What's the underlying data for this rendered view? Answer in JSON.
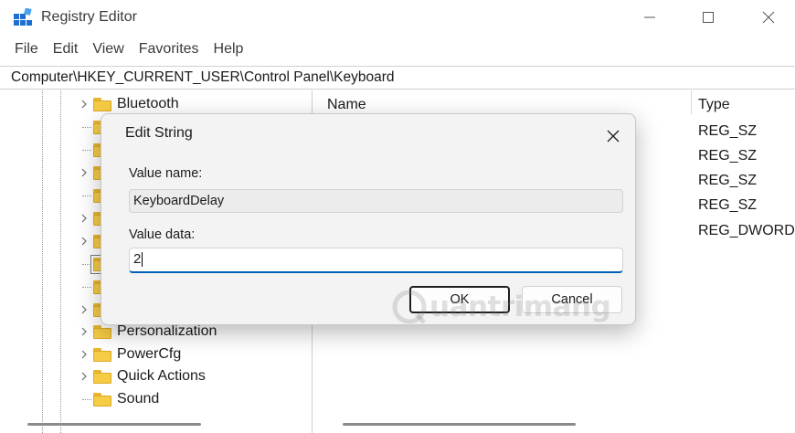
{
  "window": {
    "title": "Registry Editor",
    "icon": "registry-icon",
    "controls": [
      "minimize-icon",
      "maximize-icon",
      "close-icon"
    ]
  },
  "menu": {
    "items": [
      "File",
      "Edit",
      "View",
      "Favorites",
      "Help"
    ]
  },
  "address": {
    "path": "Computer\\HKEY_CURRENT_USER\\Control Panel\\Keyboard"
  },
  "tree": {
    "items": [
      {
        "label": "Bluetooth",
        "expandable": true
      },
      {
        "label": "",
        "expandable": false
      },
      {
        "label": "",
        "expandable": false
      },
      {
        "label": "",
        "expandable": true
      },
      {
        "label": "",
        "expandable": false
      },
      {
        "label": "",
        "expandable": true
      },
      {
        "label": "",
        "expandable": true
      },
      {
        "label": "",
        "expandable": false,
        "selected": true
      },
      {
        "label": "",
        "expandable": false
      },
      {
        "label": "",
        "expandable": true
      },
      {
        "label": "Personalization",
        "expandable": true
      },
      {
        "label": "PowerCfg",
        "expandable": true
      },
      {
        "label": "Quick Actions",
        "expandable": true
      },
      {
        "label": "Sound",
        "expandable": false
      }
    ]
  },
  "list": {
    "columns": {
      "name": "Name",
      "type": "Type"
    },
    "types": [
      "REG_SZ",
      "REG_SZ",
      "REG_SZ",
      "REG_SZ",
      "REG_DWORD"
    ]
  },
  "dialog": {
    "title": "Edit String",
    "value_name_label": "Value name:",
    "value_name": "KeyboardDelay",
    "value_data_label": "Value data:",
    "value_data": "2",
    "ok_label": "OK",
    "cancel_label": "Cancel"
  },
  "watermark": {
    "text": "uantrimang"
  },
  "colors": {
    "accent": "#005fb8",
    "folder": "#f6cc45",
    "registry_icon": "#1e6fd0"
  }
}
